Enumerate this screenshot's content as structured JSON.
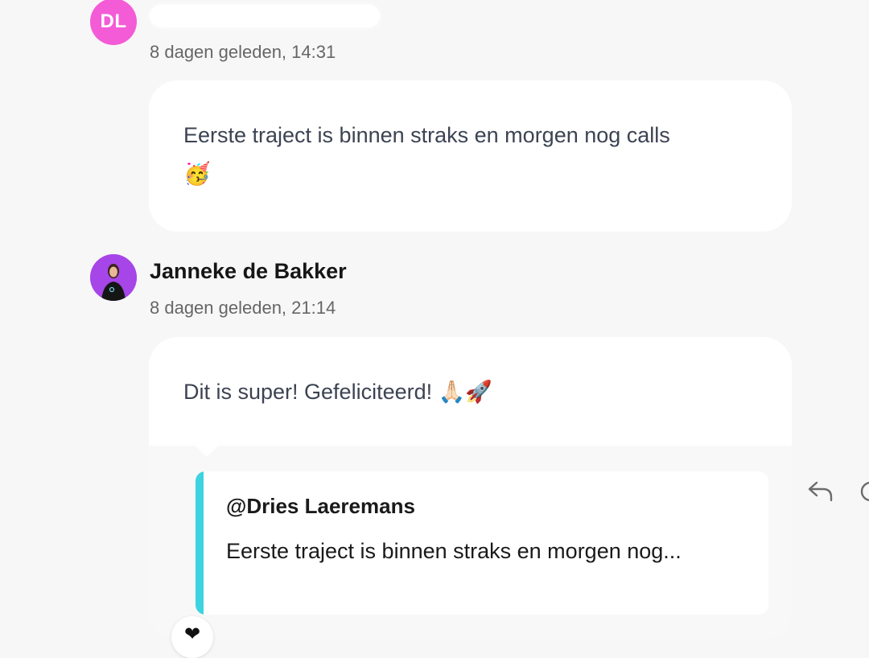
{
  "messages": [
    {
      "avatar_initials": "DL",
      "author": "",
      "timestamp": "8 dagen geleden, 14:31",
      "text": "Eerste traject is binnen straks en morgen nog calls",
      "emoji": "🥳"
    },
    {
      "author": "Janneke de Bakker",
      "timestamp": "8 dagen geleden, 21:14",
      "text": "Dit is super! Gefeliciteerd!",
      "emoji": "🙏🏻🚀",
      "reply": {
        "mention": "@Dries Laeremans",
        "excerpt": "Eerste traject is binnen straks en morgen nog..."
      },
      "reaction": "❤"
    }
  ],
  "actions": {
    "reply_icon": "reply-arrow-icon",
    "more_icon": "more-icon"
  },
  "colors": {
    "avatar_dl": "#f45bd6",
    "avatar_jb": "#a645e8",
    "quote_accent": "#3dd3e0",
    "background": "#f7f7f7"
  }
}
